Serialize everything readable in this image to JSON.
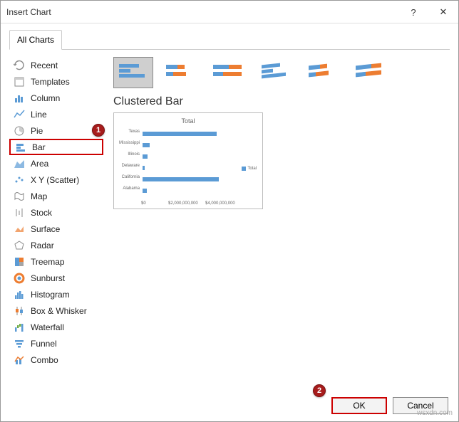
{
  "window": {
    "title": "Insert Chart",
    "help": "?",
    "close": "✕"
  },
  "tabs": {
    "all_charts": "All Charts"
  },
  "nav": {
    "recent": "Recent",
    "templates": "Templates",
    "column": "Column",
    "line": "Line",
    "pie": "Pie",
    "bar": "Bar",
    "area": "Area",
    "xy": "X Y (Scatter)",
    "map": "Map",
    "stock": "Stock",
    "surface": "Surface",
    "radar": "Radar",
    "treemap": "Treemap",
    "sunburst": "Sunburst",
    "histogram": "Histogram",
    "box": "Box & Whisker",
    "waterfall": "Waterfall",
    "funnel": "Funnel",
    "combo": "Combo"
  },
  "subtype_title": "Clustered Bar",
  "preview": {
    "title": "Total",
    "legend": "Total",
    "axis": {
      "t0": "$0",
      "t1": "$2,000,000,000",
      "t2": "$4,000,000,000"
    }
  },
  "chart_data": {
    "type": "bar",
    "title": "Total",
    "orientation": "horizontal",
    "categories": [
      "Texas",
      "Mississippi",
      "Illinois",
      "Delaware",
      "California",
      "Alabama"
    ],
    "values": [
      4000000000,
      350000000,
      250000000,
      100000000,
      4100000000,
      200000000
    ],
    "xlabel": "",
    "ylabel": "",
    "xlim": [
      0,
      5000000000
    ],
    "xticks": [
      0,
      2000000000,
      4000000000
    ],
    "series": [
      {
        "name": "Total"
      }
    ],
    "legend_position": "right"
  },
  "buttons": {
    "ok": "OK",
    "cancel": "Cancel"
  },
  "badges": {
    "one": "1",
    "two": "2"
  },
  "watermark": "wsxdn.com"
}
